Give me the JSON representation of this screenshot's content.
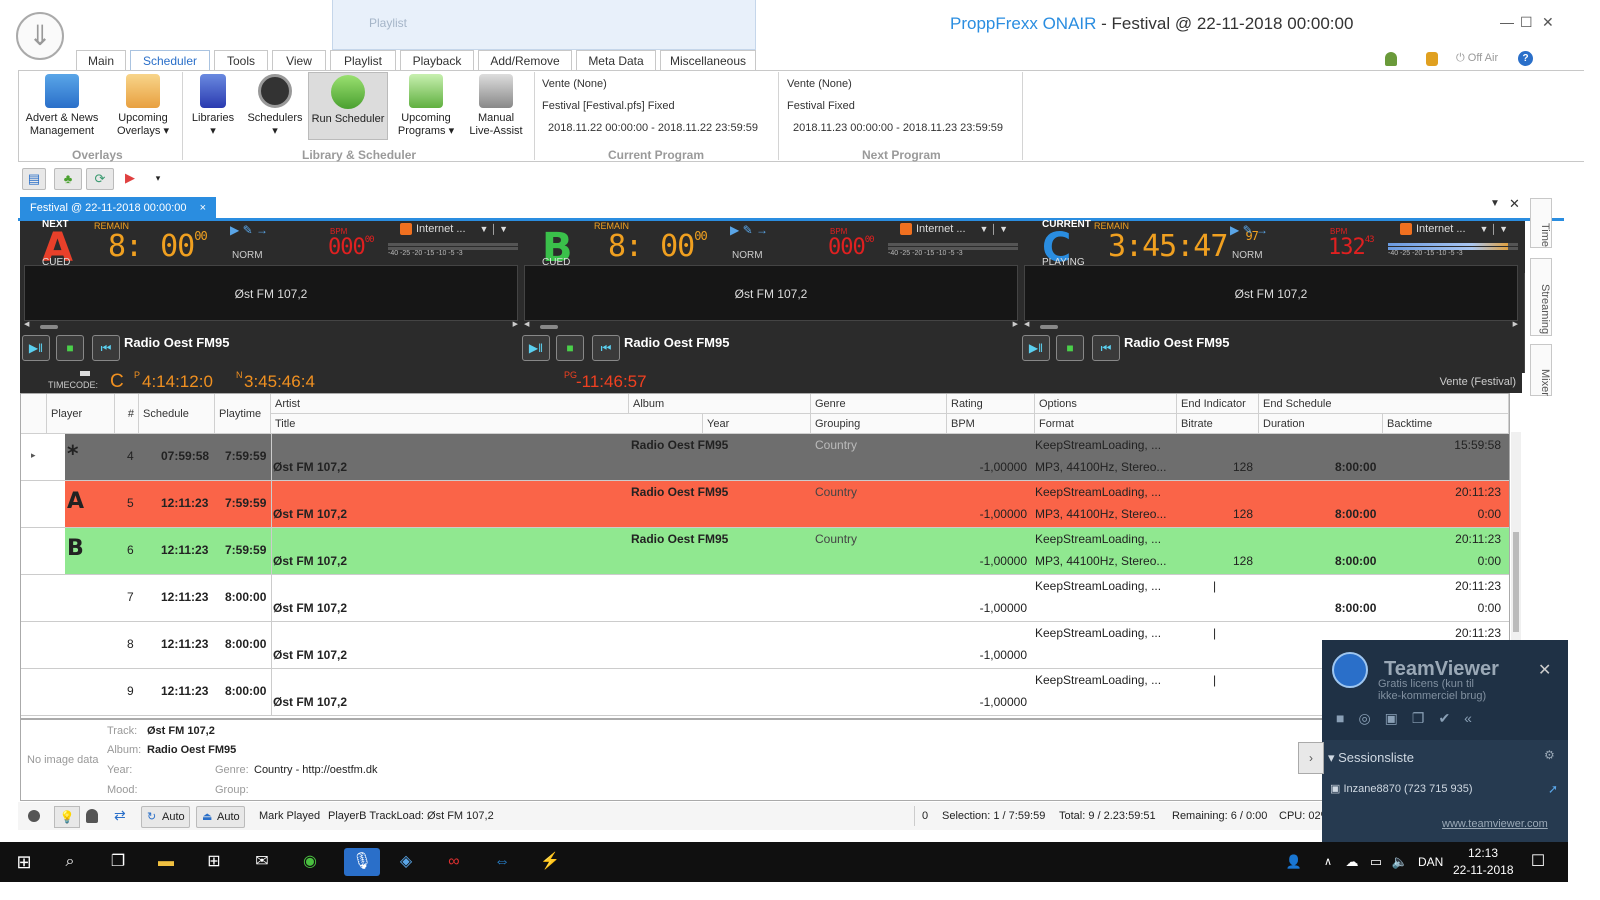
{
  "window": {
    "brand": "ProppFrexx ONAIR",
    "title_rest": " - Festival @ 22-11-2018 00:00:00",
    "context_tab": "Playlist",
    "status_offair": "Off Air"
  },
  "ribbon_tabs": [
    "Main",
    "Scheduler",
    "Tools",
    "View",
    "Playlist",
    "Playback",
    "Add/Remove",
    "Meta Data",
    "Miscellaneous"
  ],
  "ribbon": {
    "buttons": [
      {
        "label1": "Advert & News",
        "label2": "Management"
      },
      {
        "label1": "Upcoming",
        "label2": "Overlays ▾"
      },
      {
        "label1": "Libraries",
        "label2": "▾"
      },
      {
        "label1": "Schedulers",
        "label2": "▾"
      },
      {
        "label1": "Run Scheduler",
        "label2": ""
      },
      {
        "label1": "Upcoming",
        "label2": "Programs ▾"
      },
      {
        "label1": "Manual",
        "label2": "Live-Assist"
      }
    ],
    "groups": {
      "overlays": "Overlays",
      "library": "Library & Scheduler",
      "current": "Current Program",
      "next": "Next Program"
    },
    "current_program": {
      "line1": "Vente (None)",
      "line2": "Festival [Festival.pfs] Fixed",
      "line3": "2018.11.22 00:00:00 - 2018.11.22 23:59:59"
    },
    "next_program": {
      "line1": "Vente (None)",
      "line2": "Festival Fixed",
      "line3": "2018.11.23 00:00:00 - 2018.11.23 23:59:59"
    }
  },
  "doc_tab": {
    "label": "Festival @ 22-11-2018 00:00:00",
    "close": "×"
  },
  "players": [
    {
      "top": "NEXT",
      "letter": "A",
      "color": "#e8402a",
      "state": "CUED",
      "remain_label": "REMAIN",
      "remain": "8:",
      "remain2": "00",
      "remain_frac": "00",
      "bpm_label": "BPM",
      "bpm": "000",
      "bpm_frac": "00",
      "norm": "NORM",
      "input": "Internet ...",
      "wave": "Øst FM 107,2",
      "title": "Radio Oest FM95",
      "level_left": 0.0,
      "level_right": 0.0
    },
    {
      "top": "",
      "letter": "B",
      "color": "#3ac04a",
      "state": "CUED",
      "remain_label": "REMAIN",
      "remain": "8:",
      "remain2": "00",
      "remain_frac": "00",
      "bpm_label": "BPM",
      "bpm": "000",
      "bpm_frac": "00",
      "norm": "NORM",
      "input": "Internet ...",
      "wave": "Øst FM 107,2",
      "title": "Radio Oest FM95",
      "level_left": 0.0,
      "level_right": 0.0
    },
    {
      "top": "CURRENT",
      "letter": "C",
      "color": "#2a8de0",
      "state": "PLAYING",
      "remain_label": "REMAIN",
      "remain": "3:45:47",
      "remain2": "",
      "remain_frac": "97",
      "bpm_label": "BPM",
      "bpm": "132",
      "bpm_frac": "43",
      "norm": "NORM",
      "input": "Internet ...",
      "wave": "Øst FM 107,2",
      "title": "Radio Oest FM95",
      "level_left": 0.92,
      "level_right": 0.92
    }
  ],
  "meter_scale": "-40  -25 -20  -15   -10    -5  -3",
  "timecode": {
    "label": "TIMECODE:",
    "c": "C",
    "p_sup": "P",
    "p": "4:14:12:0",
    "n_sup": "N",
    "n": "3:45:46:4",
    "pg_sup": "PG",
    "pg": "-11:46:57",
    "right": "Vente (Festival)"
  },
  "grid": {
    "headers_top": [
      "Player",
      "#",
      "Schedule",
      "Playtime",
      "Artist",
      "Album",
      "Genre",
      "Rating",
      "Options",
      "End Indicator",
      "End Schedule"
    ],
    "headers_bottom": [
      "Title",
      "Year",
      "Grouping",
      "BPM",
      "Format",
      "Bitrate",
      "Duration",
      "Backtime"
    ],
    "rows": [
      {
        "mark": "*",
        "num": "4",
        "schedule": "07:59:58",
        "playtime": "7:59:59",
        "album": "Radio Oest FM95",
        "genre": "Country",
        "options": "KeepStreamLoading, ...",
        "endsched": "15:59:58",
        "title": "Øst FM 107,2",
        "bpm": "-1,00000",
        "format": "MP3, 44100Hz, Stereo...",
        "bitrate": "128",
        "duration": "8:00:00",
        "backtime": "",
        "bg": "#6e6e6e"
      },
      {
        "mark": "A",
        "num": "5",
        "schedule": "12:11:23",
        "playtime": "7:59:59",
        "album": "Radio Oest FM95",
        "genre": "Country",
        "options": "KeepStreamLoading, ...",
        "endsched": "20:11:23",
        "title": "Øst FM 107,2",
        "bpm": "-1,00000",
        "format": "MP3, 44100Hz, Stereo...",
        "bitrate": "128",
        "duration": "8:00:00",
        "backtime": "0:00",
        "bg": "#fa6448"
      },
      {
        "mark": "B",
        "num": "6",
        "schedule": "12:11:23",
        "playtime": "7:59:59",
        "album": "Radio Oest FM95",
        "genre": "Country",
        "options": "KeepStreamLoading, ...",
        "endsched": "20:11:23",
        "title": "Øst FM 107,2",
        "bpm": "-1,00000",
        "format": "MP3, 44100Hz, Stereo...",
        "bitrate": "128",
        "duration": "8:00:00",
        "backtime": "0:00",
        "bg": "#90e890"
      },
      {
        "mark": "",
        "num": "7",
        "schedule": "12:11:23",
        "playtime": "8:00:00",
        "album": "",
        "genre": "",
        "options": "KeepStreamLoading, ...",
        "endsched": "20:11:23",
        "title": "Øst FM 107,2",
        "bpm": "-1,00000",
        "format": "",
        "bitrate": "",
        "duration": "8:00:00",
        "backtime": "0:00",
        "bg": "#ffffff"
      },
      {
        "mark": "",
        "num": "8",
        "schedule": "12:11:23",
        "playtime": "8:00:00",
        "album": "",
        "genre": "",
        "options": "KeepStreamLoading, ...",
        "endsched": "20:11:23",
        "title": "Øst FM 107,2",
        "bpm": "-1,00000",
        "format": "",
        "bitrate": "",
        "duration": "",
        "backtime": "",
        "bg": "#ffffff"
      },
      {
        "mark": "",
        "num": "9",
        "schedule": "12:11:23",
        "playtime": "8:00:00",
        "album": "",
        "genre": "",
        "options": "KeepStreamLoading, ...",
        "endsched": "",
        "title": "Øst FM 107,2",
        "bpm": "-1,00000",
        "format": "",
        "bitrate": "",
        "duration": "",
        "backtime": "",
        "bg": "#ffffff"
      }
    ]
  },
  "info": {
    "no_image": "No image data",
    "track_l": "Track:",
    "track": "Øst FM 107,2",
    "album_l": "Album:",
    "album": "Radio Oest FM95",
    "year_l": "Year:",
    "genre_l": "Genre:",
    "genre": "Country - http://oestfm.dk",
    "mood_l": "Mood:",
    "group_l": "Group:"
  },
  "status": {
    "auto1": "Auto",
    "auto2": "Auto",
    "mark": "Mark Played",
    "trackload": "PlayerB TrackLoad: Øst FM 107,2",
    "zero": "0",
    "selection": "Selection: 1 / 7:59:59",
    "total": "Total: 9 / 2.23:59:51",
    "remaining": "Remaining: 6 / 0:00",
    "cpu": "CPU: 02%"
  },
  "side_tabs": [
    "Time",
    "Streaming",
    "Mixer"
  ],
  "teamviewer": {
    "brand": "TeamViewer",
    "sub1": "Gratis licens (kun til",
    "sub2": "ikke-kommerciel brug)",
    "sessions": "Sessionsliste",
    "user": "Inzane8870 (723 715 935)",
    "link": "www.teamviewer.com"
  },
  "taskbar": {
    "lang": "DAN",
    "time": "12:13",
    "date": "22-11-2018"
  }
}
